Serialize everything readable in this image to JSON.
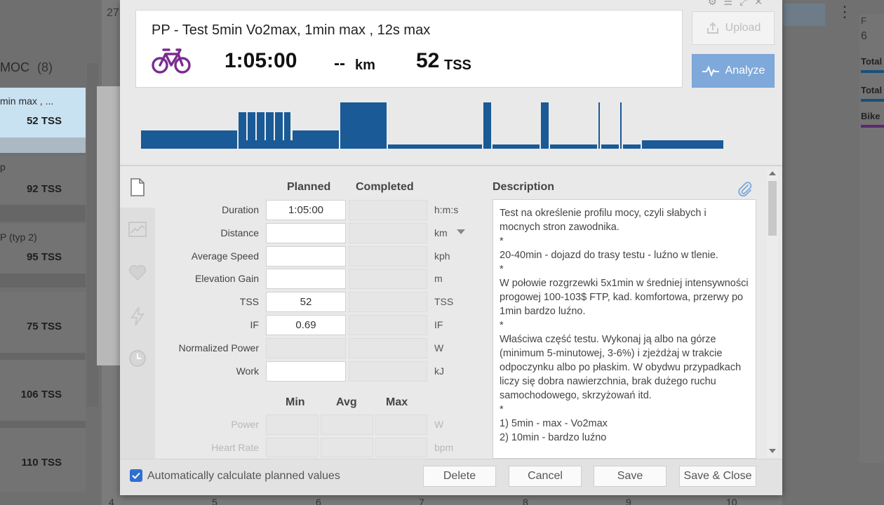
{
  "background": {
    "top_date": "27",
    "column_header": "MOC",
    "column_count": "(8)",
    "cards": [
      {
        "sub": "min max , ...",
        "tss": "52 TSS",
        "selected": true
      },
      {
        "sub": "p",
        "tss": "92 TSS"
      },
      {
        "sub": "P (typ 2)",
        "tss": "95 TSS"
      },
      {
        "sub": "",
        "tss": "75 TSS"
      },
      {
        "sub": "",
        "tss": "106 TSS"
      },
      {
        "sub": "",
        "tss": "110 TSS"
      }
    ],
    "right_labels": [
      "Total",
      "Total",
      "Bike"
    ],
    "right_top": "F",
    "right_top_num": "6",
    "bottom_numbers": [
      "4",
      "5",
      "6",
      "7",
      "8",
      "9",
      "10"
    ]
  },
  "summary": {
    "title": "PP - Test 5min Vo2max, 1min max , 12s max",
    "duration": "1:05:00",
    "distance": "--",
    "distance_unit": "km",
    "tss": "52",
    "tss_unit": "TSS",
    "sport_icon": "bike-icon",
    "sport_color": "#7a2c8f"
  },
  "buttons": {
    "upload": "Upload",
    "analyze": "Analyze"
  },
  "chart_data": {
    "type": "bar",
    "note": "workout structure intensity profile",
    "color": "#1a5a96",
    "segments": [
      {
        "w": 137,
        "h": 26
      },
      {
        "w": 2,
        "h": 0
      },
      {
        "w": 11,
        "h": 52
      },
      {
        "w": 2,
        "h": 12
      },
      {
        "w": 11,
        "h": 52
      },
      {
        "w": 2,
        "h": 12
      },
      {
        "w": 11,
        "h": 52
      },
      {
        "w": 2,
        "h": 12
      },
      {
        "w": 11,
        "h": 52
      },
      {
        "w": 2,
        "h": 12
      },
      {
        "w": 11,
        "h": 52
      },
      {
        "w": 2,
        "h": 12
      },
      {
        "w": 9,
        "h": 52
      },
      {
        "w": 3,
        "h": 12
      },
      {
        "w": 66,
        "h": 26
      },
      {
        "w": 2,
        "h": 0
      },
      {
        "w": 66,
        "h": 66
      },
      {
        "w": 2,
        "h": 0
      },
      {
        "w": 134,
        "h": 6
      },
      {
        "w": 2,
        "h": 0
      },
      {
        "w": 11,
        "h": 66
      },
      {
        "w": 2,
        "h": 0
      },
      {
        "w": 67,
        "h": 6
      },
      {
        "w": 2,
        "h": 0
      },
      {
        "w": 11,
        "h": 66
      },
      {
        "w": 2,
        "h": 0
      },
      {
        "w": 67,
        "h": 6
      },
      {
        "w": 2,
        "h": 0
      },
      {
        "w": 2,
        "h": 66
      },
      {
        "w": 2,
        "h": 0
      },
      {
        "w": 25,
        "h": 6
      },
      {
        "w": 2,
        "h": 0
      },
      {
        "w": 2,
        "h": 66
      },
      {
        "w": 2,
        "h": 0
      },
      {
        "w": 25,
        "h": 6
      },
      {
        "w": 2,
        "h": 0
      },
      {
        "w": 116,
        "h": 12
      }
    ]
  },
  "form": {
    "col_planned": "Planned",
    "col_completed": "Completed",
    "rows": [
      {
        "label": "Duration",
        "planned": "1:05:00",
        "unit": "h:m:s"
      },
      {
        "label": "Distance",
        "planned": "",
        "unit": "km"
      },
      {
        "label": "Average Speed",
        "planned": "",
        "unit": "kph"
      },
      {
        "label": "Elevation Gain",
        "planned": "",
        "unit": "m"
      },
      {
        "label": "TSS",
        "planned": "52",
        "unit": "TSS"
      },
      {
        "label": "IF",
        "planned": "0.69",
        "unit": "IF"
      },
      {
        "label": "Normalized Power",
        "planned": "",
        "unit": "W"
      },
      {
        "label": "Work",
        "planned": "",
        "unit": "kJ"
      }
    ],
    "col_min": "Min",
    "col_avg": "Avg",
    "col_max": "Max",
    "range_rows": [
      {
        "label": "Power",
        "unit": "W"
      },
      {
        "label": "Heart Rate",
        "unit": "bpm"
      }
    ]
  },
  "description": {
    "header": "Description",
    "text": "Test na określenie profilu mocy, czyli słabych i mocnych stron zawodnika.\n*\n20-40min - dojazd do trasy testu - luźno w tlenie.\n*\nW połowie rozgrzewki 5x1min w średniej intensywności progowej 100-103$ FTP, kad. komfortowa, przerwy po 1min bardzo luźno.\n*\nWłaściwa część testu. Wykonaj ją albo na górze (minimum 5-minutowej, 3-6%) i zjeżdżaj w trakcie odpoczynku albo po płaskim. W obydwu przypadkach liczy się dobra nawierzchnia, brak dużego ruchu samochodowego, skrzyżowań itd.\n*\n1) 5min - max - Vo2max\n2) 10min - bardzo luźno"
  },
  "footer": {
    "auto_calc_label": "Automatically calculate planned values",
    "auto_calc_checked": true,
    "delete": "Delete",
    "cancel": "Cancel",
    "save": "Save",
    "save_close": "Save & Close"
  }
}
